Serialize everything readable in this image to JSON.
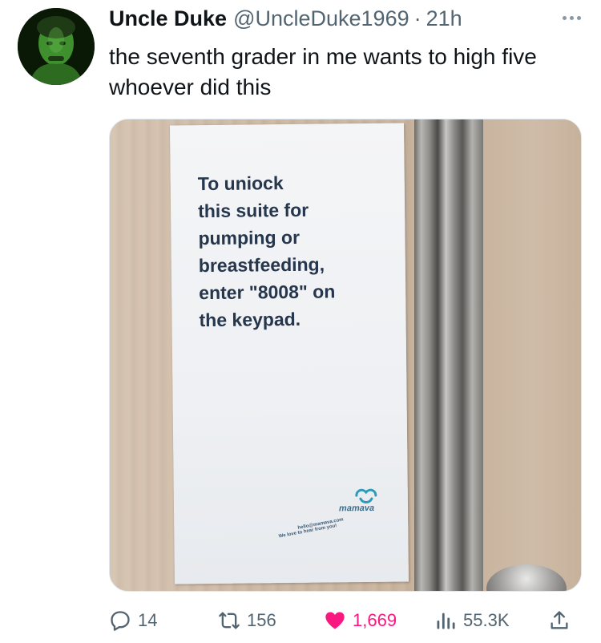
{
  "tweet": {
    "display_name": "Uncle Duke",
    "handle": "@UncleDuke1969",
    "separator": "·",
    "time": "21h",
    "text": "the seventh grader in me wants to high five whoever did this"
  },
  "media": {
    "sign_text": "To uniock\nthis suite for\npumping or\nbreastfeeding,\nenter \"8008\" on\nthe keypad.",
    "brand_name": "mamava",
    "brand_email": "hello@mamava.com",
    "brand_tagline": "We love to hear from you!"
  },
  "actions": {
    "replies": "14",
    "retweets": "156",
    "likes": "1,669",
    "views": "55.3K"
  },
  "colors": {
    "text_primary": "#0f1419",
    "text_secondary": "#536471",
    "like": "#f91880"
  },
  "icons": {
    "reply": "reply-icon",
    "retweet": "retweet-icon",
    "like": "heart-icon",
    "views": "views-icon",
    "share": "share-icon",
    "more": "more-icon"
  }
}
